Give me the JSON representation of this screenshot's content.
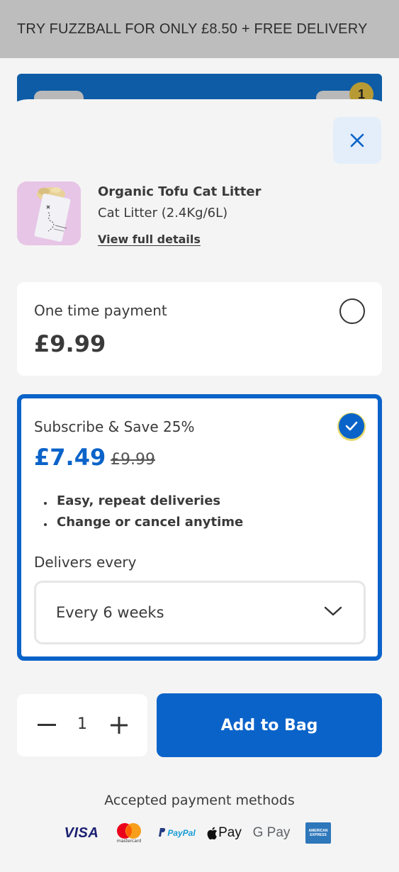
{
  "promo": {
    "text": "TRY FUZZBALL FOR ONLY £8.50 + FREE DELIVERY"
  },
  "header": {
    "cart_count": "1"
  },
  "product": {
    "name": "Organic Tofu Cat Litter",
    "variant": "Cat Litter (2.4Kg/6L)",
    "details_link": "View full details"
  },
  "options": {
    "one_time": {
      "title": "One time payment",
      "price": "£9.99",
      "selected": false
    },
    "subscribe": {
      "title": "Subscribe & Save 25%",
      "price": "£7.49",
      "original_price": "£9.99",
      "selected": true,
      "benefits": [
        "Easy, repeat deliveries",
        "Change or cancel anytime"
      ],
      "delivery_label": "Delivers every",
      "delivery_value": "Every 6 weeks"
    }
  },
  "quantity": {
    "value": "1"
  },
  "add_to_bag": {
    "label": "Add to Bag"
  },
  "payments": {
    "label": "Accepted payment methods",
    "methods": [
      "VISA",
      "mastercard",
      "PayPal",
      "Pay",
      "G Pay",
      "AMERICAN EXPRESS"
    ]
  },
  "colors": {
    "accent": "#0a63c9",
    "background": "#f4f4f4"
  }
}
